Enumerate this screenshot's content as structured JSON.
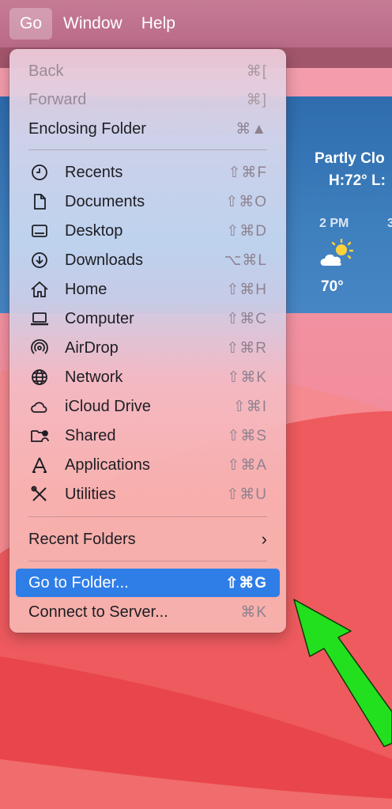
{
  "menubar": {
    "items": [
      "Go",
      "Window",
      "Help"
    ]
  },
  "weather": {
    "condition": "Partly Clo",
    "hilo": "H:72° L:",
    "hours": [
      "2 PM",
      "3"
    ],
    "temp": "70°",
    "icon": "partly-cloudy-icon"
  },
  "menu": {
    "nav": {
      "back": {
        "label": "Back",
        "shortcut": "⌘["
      },
      "forward": {
        "label": "Forward",
        "shortcut": "⌘]"
      },
      "enclosing": {
        "label": "Enclosing Folder",
        "shortcut": "⌘▲"
      }
    },
    "places": [
      {
        "label": "Recents",
        "shortcut": "⇧⌘F",
        "icon": "clock-icon"
      },
      {
        "label": "Documents",
        "shortcut": "⇧⌘O",
        "icon": "document-icon"
      },
      {
        "label": "Desktop",
        "shortcut": "⇧⌘D",
        "icon": "desktop-icon"
      },
      {
        "label": "Downloads",
        "shortcut": "⌥⌘L",
        "icon": "download-icon"
      },
      {
        "label": "Home",
        "shortcut": "⇧⌘H",
        "icon": "home-icon"
      },
      {
        "label": "Computer",
        "shortcut": "⇧⌘C",
        "icon": "laptop-icon"
      },
      {
        "label": "AirDrop",
        "shortcut": "⇧⌘R",
        "icon": "airdrop-icon"
      },
      {
        "label": "Network",
        "shortcut": "⇧⌘K",
        "icon": "globe-icon"
      },
      {
        "label": "iCloud Drive",
        "shortcut": "⇧⌘I",
        "icon": "cloud-icon"
      },
      {
        "label": "Shared",
        "shortcut": "⇧⌘S",
        "icon": "shared-folder-icon"
      },
      {
        "label": "Applications",
        "shortcut": "⇧⌘A",
        "icon": "applications-icon"
      },
      {
        "label": "Utilities",
        "shortcut": "⇧⌘U",
        "icon": "utilities-icon"
      }
    ],
    "recent_folders": {
      "label": "Recent Folders",
      "chevron": "›"
    },
    "go_to_folder": {
      "label": "Go to Folder...",
      "shortcut": "⇧⌘G"
    },
    "connect": {
      "label": "Connect to Server...",
      "shortcut": "⌘K"
    }
  },
  "colors": {
    "highlight": "#2f7ee8",
    "arrow": "#22e01e",
    "menubar": "#c07590"
  }
}
